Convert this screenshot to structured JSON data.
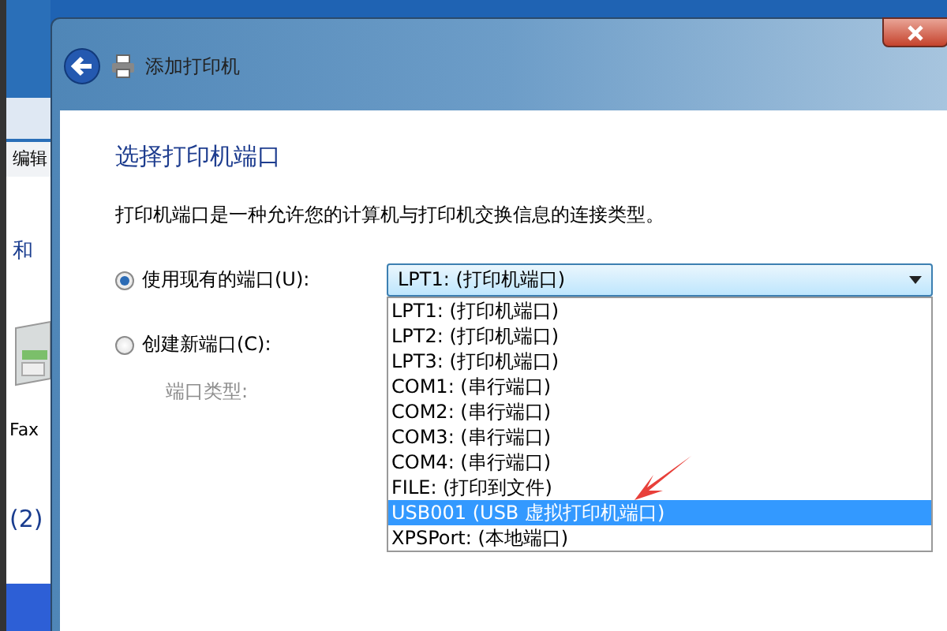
{
  "background_window": {
    "menu_item": "编辑",
    "texts": [
      "和",
      "Fax",
      "(2)"
    ]
  },
  "dialog": {
    "title": "添加打印机",
    "heading": "选择打印机端口",
    "description": "打印机端口是一种允许您的计算机与打印机交换信息的连接类型。",
    "options": [
      {
        "label": "使用现有的端口(U):",
        "selected": true
      },
      {
        "label": "创建新端口(C):",
        "selected": false
      }
    ],
    "port_type": {
      "label": "端口类型:",
      "disabled": true
    },
    "port_combo": {
      "value": "LPT1: (打印机端口)",
      "expanded": true,
      "items": [
        {
          "label": "LPT1: (打印机端口)",
          "highlighted": false
        },
        {
          "label": "LPT2: (打印机端口)",
          "highlighted": false
        },
        {
          "label": "LPT3: (打印机端口)",
          "highlighted": false
        },
        {
          "label": "COM1: (串行端口)",
          "highlighted": false
        },
        {
          "label": "COM2: (串行端口)",
          "highlighted": false
        },
        {
          "label": "COM3: (串行端口)",
          "highlighted": false
        },
        {
          "label": "COM4: (串行端口)",
          "highlighted": false
        },
        {
          "label": "FILE: (打印到文件)",
          "highlighted": false
        },
        {
          "label": "USB001 (USB 虚拟打印机端口)",
          "highlighted": true
        },
        {
          "label": "XPSPort: (本地端口)",
          "highlighted": false
        }
      ]
    }
  }
}
